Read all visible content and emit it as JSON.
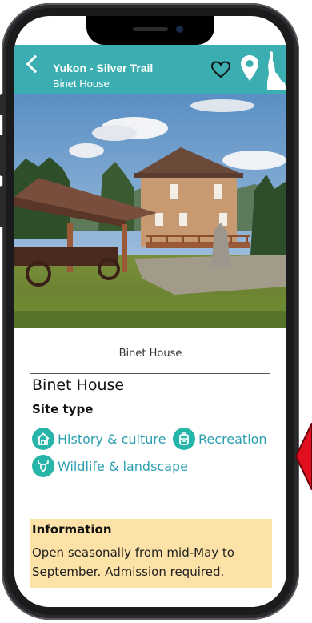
{
  "header": {
    "title": "Yukon - Silver Trail",
    "subtitle": "Binet House",
    "icons": [
      "back-chevron-icon",
      "heart-icon",
      "map-pin-icon",
      "yukon-map-icon"
    ]
  },
  "photo": {
    "subject": "binet-house-photo"
  },
  "content": {
    "caption": "Binet House",
    "name": "Binet House",
    "site_type_label": "Site type",
    "site_types": [
      {
        "label": "History & culture",
        "icon": "house-icon"
      },
      {
        "label": "Recreation",
        "icon": "backpack-icon"
      },
      {
        "label": "Wildlife & landscape",
        "icon": "deer-icon"
      }
    ],
    "info_heading": "Information",
    "info_text": "Open seasonally from mid-May to September. Admission required."
  },
  "colors": {
    "header_bg": "#3aaeb0",
    "tag_icon_bg": "#26b5a8",
    "tag_text": "#2a9fb0",
    "info_bg": "#fce2a6",
    "marker": "#e0101e"
  }
}
